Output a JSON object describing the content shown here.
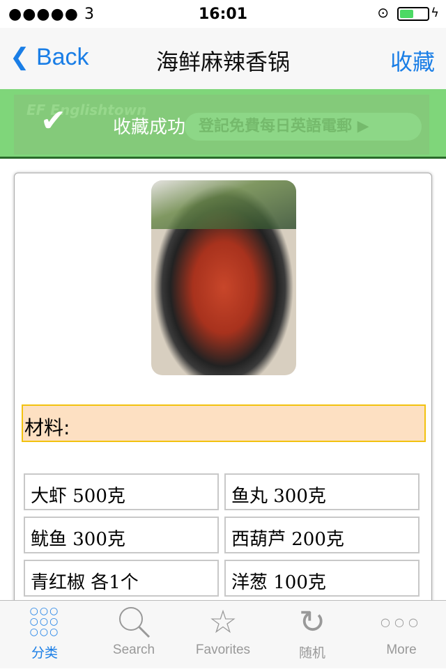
{
  "status": {
    "signal": "●●●●● 3",
    "wifi_icon": "wifi-icon",
    "time": "16:01",
    "battery_level": 0.45
  },
  "nav": {
    "back": "Back",
    "title": "海鲜麻辣香锅",
    "favorite": "收藏"
  },
  "toast": {
    "message": "收藏成功"
  },
  "ad": {
    "brand": "EF Englishtown",
    "cta": "登記免費每日英語電郵 ▶"
  },
  "content": {
    "section_title": "材料:",
    "ingredients": [
      [
        "大虾 500克",
        "鱼丸 300克"
      ],
      [
        "鱿鱼 300克",
        "西葫芦 200克"
      ],
      [
        "青红椒 各1个",
        "洋葱 100克"
      ]
    ]
  },
  "tabs": [
    {
      "label": "分类",
      "icon": "grid-icon",
      "active": true
    },
    {
      "label": "Search",
      "icon": "search-icon"
    },
    {
      "label": "Favorites",
      "icon": "star-icon"
    },
    {
      "label": "随机",
      "icon": "refresh-icon"
    },
    {
      "label": "More",
      "icon": "more-icon"
    }
  ],
  "colors": {
    "accent": "#1a7ee6",
    "toast": "#7fd67a",
    "section_bg": "#fde0c2",
    "section_border": "#f2c20f"
  }
}
